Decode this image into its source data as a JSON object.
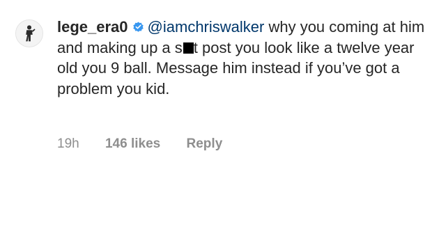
{
  "comment": {
    "username": "lege_era0",
    "verified_icon": "verified-badge-icon",
    "mention": "@iamchriswalker",
    "text_before_censor": " why you coming at him and making up a s",
    "censored_icon": "censor-bar",
    "text_after_censor": "t post you look like a twelve year old you 9 ball. Message him instead if you’ve got a problem you kid.",
    "avatar_icon": "user-avatar-icon"
  },
  "meta": {
    "time": "19h",
    "likes": "146 likes",
    "reply_label": "Reply"
  },
  "colors": {
    "text": "#262626",
    "mention": "#00376b",
    "meta": "#8e8e8e",
    "verified": "#3897f0"
  }
}
